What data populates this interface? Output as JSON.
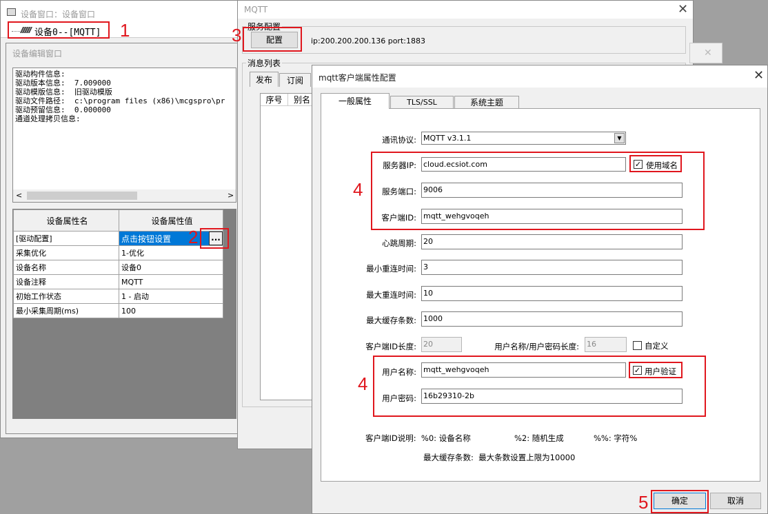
{
  "device_window": {
    "title": "设备窗口：设备窗口",
    "tree_item": "设备0--[MQTT]"
  },
  "edit_window": {
    "title": "设备编辑窗口",
    "info_lines": [
      "驱动构件信息:",
      "驱动版本信息:  7.009000",
      "驱动模版信息:  旧驱动模版",
      "驱动文件路径:  c:\\program files (x86)\\mcgspro\\pr",
      "驱动预留信息:  0.000000",
      "通道处理拷贝信息:"
    ],
    "table_headers": [
      "设备属性名",
      "设备属性值"
    ],
    "rows": [
      [
        "[驱动配置]",
        "点击按钮设置"
      ],
      [
        "采集优化",
        "1-优化"
      ],
      [
        "设备名称",
        "设备0"
      ],
      [
        "设备注释",
        "MQTT"
      ],
      [
        "初始工作状态",
        "1 - 启动"
      ],
      [
        "最小采集周期(ms)",
        "100"
      ]
    ],
    "ellipsis": "..."
  },
  "mqtt_window": {
    "title": "MQTT",
    "service_group": "服务配置",
    "config_button": "配置",
    "server_info": "ip:200.200.200.136 port:1883",
    "msg_group": "消息列表",
    "tabs": [
      "发布",
      "订阅"
    ],
    "list_headers": [
      "序号",
      "别名"
    ]
  },
  "dialog": {
    "title": "mqtt客户端属性配置",
    "tabs": [
      "一般属性",
      "TLS/SSL",
      "系统主题"
    ],
    "protocol_label": "通讯协议:",
    "protocol_value": "MQTT v3.1.1",
    "server_ip_label": "服务器IP:",
    "server_ip_value": "cloud.ecsiot.com",
    "use_domain_label": "使用域名",
    "port_label": "服务端口:",
    "port_value": "9006",
    "client_id_label": "客户端ID:",
    "client_id_value": "mqtt_wehgvoqeh",
    "heartbeat_label": "心跳周期:",
    "heartbeat_value": "20",
    "min_reconnect_label": "最小重连时间:",
    "min_reconnect_value": "3",
    "max_reconnect_label": "最大重连时间:",
    "max_reconnect_value": "10",
    "max_cache_label": "最大缓存条数:",
    "max_cache_value": "1000",
    "client_id_len_label": "客户端ID长度:",
    "client_id_len_value": "20",
    "user_pwd_len_label": "用户名称/用户密码长度:",
    "user_pwd_len_value": "16",
    "custom_label": "自定义",
    "username_label": "用户名称:",
    "username_value": "mqtt_wehgvoqeh",
    "user_auth_label": "用户验证",
    "password_label": "用户密码:",
    "password_value": "16b29310-2b",
    "note_client_id": "客户端ID说明:  %0: 设备名称",
    "note_random": "%2: 随机生成",
    "note_percent": "%%: 字符%",
    "note_max_cache": "最大缓存条数:  最大条数设置上限为10000",
    "ok_button": "确定",
    "cancel_button": "取消"
  },
  "annotations": [
    "1",
    "2",
    "3",
    "4",
    "4",
    "5"
  ],
  "colors": {
    "annotation_red": "#e0161d",
    "selection_blue": "#0078d7"
  }
}
